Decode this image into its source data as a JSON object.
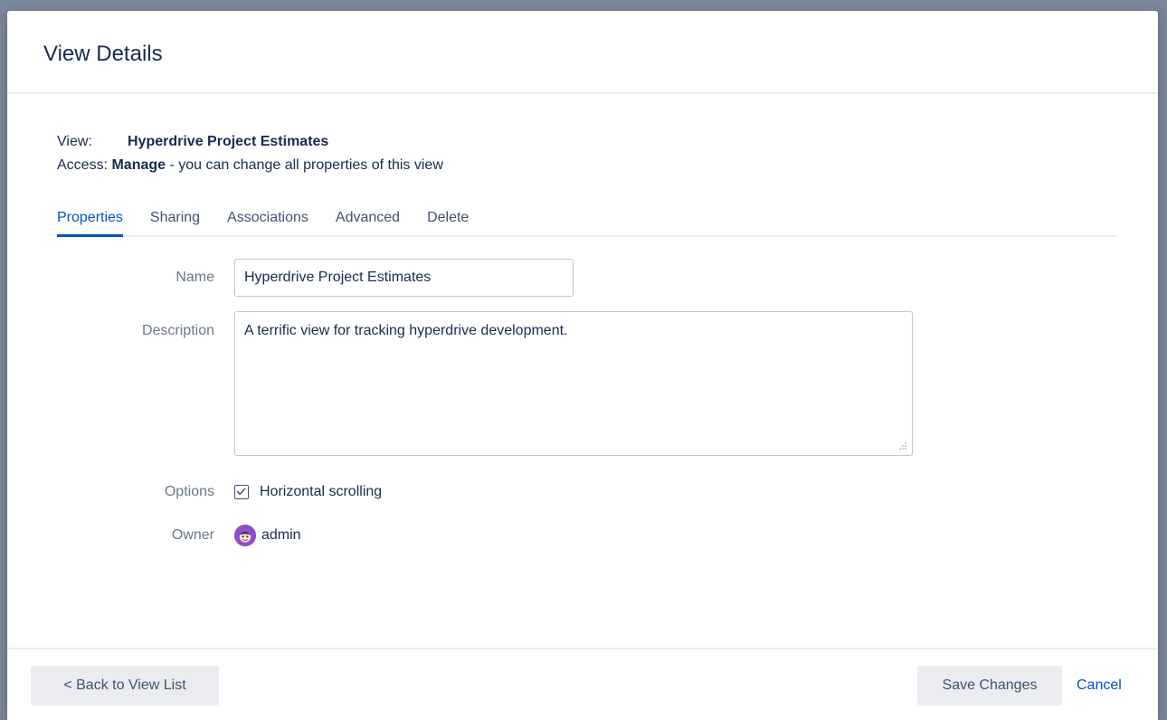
{
  "dialog": {
    "title": "View Details"
  },
  "view_info": {
    "view_label": "View:",
    "view_name": "Hyperdrive Project Estimates",
    "access_label": "Access:",
    "access_level": "Manage",
    "access_desc": " - you can change all properties of this view"
  },
  "tabs": [
    {
      "label": "Properties",
      "active": true
    },
    {
      "label": "Sharing",
      "active": false
    },
    {
      "label": "Associations",
      "active": false
    },
    {
      "label": "Advanced",
      "active": false
    },
    {
      "label": "Delete",
      "active": false
    }
  ],
  "form": {
    "name_label": "Name",
    "name_value": "Hyperdrive Project Estimates",
    "description_label": "Description",
    "description_value": "A terrific view for tracking hyperdrive development.",
    "options_label": "Options",
    "horizontal_scrolling_label": "Horizontal scrolling",
    "horizontal_scrolling_checked": true,
    "owner_label": "Owner",
    "owner_name": "admin"
  },
  "footer": {
    "back_label": "< Back to View List",
    "save_label": "Save Changes",
    "cancel_label": "Cancel"
  },
  "colors": {
    "accent": "#0052cc",
    "backdrop": "#7a869a",
    "avatar": "#8e4ec6"
  }
}
